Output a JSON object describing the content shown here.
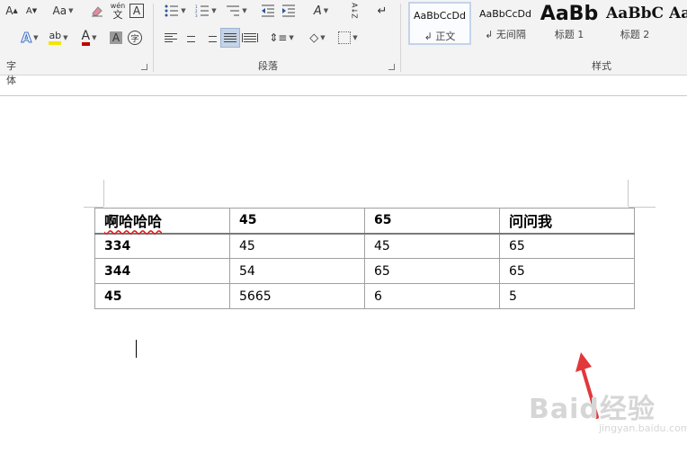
{
  "ribbon": {
    "font_group_label": "字体",
    "paragraph_group_label": "段落",
    "styles_group_label": "样式",
    "font_buttons": {
      "grow": "A",
      "shrink": "A",
      "change_case": "Aa",
      "phonetic_top": "wén",
      "phonetic_bottom": "文",
      "char_border": "A",
      "text_effect": "A",
      "highlight": "ab",
      "font_color": "A",
      "char_shading": "A",
      "enclose_char": "字"
    },
    "paragraph_buttons": {
      "sort": "A↓Z",
      "asian_layout": "A"
    },
    "styles": [
      {
        "sample": "AaBbCcDd",
        "name": "正文"
      },
      {
        "sample": "AaBbCcDd",
        "name": "无间隔"
      },
      {
        "sample": "AaBb",
        "name": "标题 1"
      },
      {
        "sample": "AaBbC",
        "name": "标题 2"
      },
      {
        "sample": "Aa",
        "name": ""
      }
    ],
    "colors": {
      "highlight": "#f5e400",
      "font_color": "#c00000",
      "active_button": "#c5d3e6"
    }
  },
  "document": {
    "table": [
      [
        "啊哈哈哈",
        "45",
        "65",
        "问问我"
      ],
      [
        "334",
        "45",
        "45",
        "65"
      ],
      [
        "344",
        "54",
        "65",
        "65"
      ],
      [
        "45",
        "5665",
        "6",
        "5"
      ]
    ]
  },
  "watermark": {
    "main": "Baid经验",
    "sub": "jingyan.baidu.com"
  }
}
